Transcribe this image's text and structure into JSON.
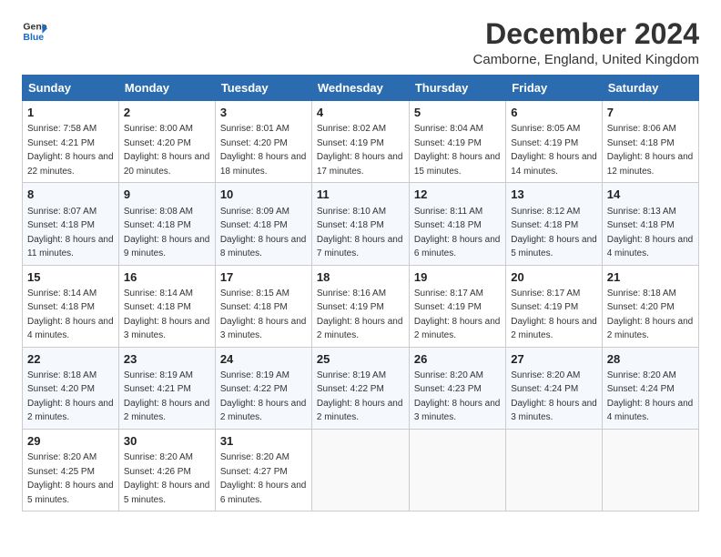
{
  "logo": {
    "line1": "General",
    "line2": "Blue"
  },
  "title": "December 2024",
  "location": "Camborne, England, United Kingdom",
  "days_of_week": [
    "Sunday",
    "Monday",
    "Tuesday",
    "Wednesday",
    "Thursday",
    "Friday",
    "Saturday"
  ],
  "weeks": [
    [
      {
        "day": "1",
        "sunrise": "7:58 AM",
        "sunset": "4:21 PM",
        "daylight": "8 hours and 22 minutes."
      },
      {
        "day": "2",
        "sunrise": "8:00 AM",
        "sunset": "4:20 PM",
        "daylight": "8 hours and 20 minutes."
      },
      {
        "day": "3",
        "sunrise": "8:01 AM",
        "sunset": "4:20 PM",
        "daylight": "8 hours and 18 minutes."
      },
      {
        "day": "4",
        "sunrise": "8:02 AM",
        "sunset": "4:19 PM",
        "daylight": "8 hours and 17 minutes."
      },
      {
        "day": "5",
        "sunrise": "8:04 AM",
        "sunset": "4:19 PM",
        "daylight": "8 hours and 15 minutes."
      },
      {
        "day": "6",
        "sunrise": "8:05 AM",
        "sunset": "4:19 PM",
        "daylight": "8 hours and 14 minutes."
      },
      {
        "day": "7",
        "sunrise": "8:06 AM",
        "sunset": "4:18 PM",
        "daylight": "8 hours and 12 minutes."
      }
    ],
    [
      {
        "day": "8",
        "sunrise": "8:07 AM",
        "sunset": "4:18 PM",
        "daylight": "8 hours and 11 minutes."
      },
      {
        "day": "9",
        "sunrise": "8:08 AM",
        "sunset": "4:18 PM",
        "daylight": "8 hours and 9 minutes."
      },
      {
        "day": "10",
        "sunrise": "8:09 AM",
        "sunset": "4:18 PM",
        "daylight": "8 hours and 8 minutes."
      },
      {
        "day": "11",
        "sunrise": "8:10 AM",
        "sunset": "4:18 PM",
        "daylight": "8 hours and 7 minutes."
      },
      {
        "day": "12",
        "sunrise": "8:11 AM",
        "sunset": "4:18 PM",
        "daylight": "8 hours and 6 minutes."
      },
      {
        "day": "13",
        "sunrise": "8:12 AM",
        "sunset": "4:18 PM",
        "daylight": "8 hours and 5 minutes."
      },
      {
        "day": "14",
        "sunrise": "8:13 AM",
        "sunset": "4:18 PM",
        "daylight": "8 hours and 4 minutes."
      }
    ],
    [
      {
        "day": "15",
        "sunrise": "8:14 AM",
        "sunset": "4:18 PM",
        "daylight": "8 hours and 4 minutes."
      },
      {
        "day": "16",
        "sunrise": "8:14 AM",
        "sunset": "4:18 PM",
        "daylight": "8 hours and 3 minutes."
      },
      {
        "day": "17",
        "sunrise": "8:15 AM",
        "sunset": "4:18 PM",
        "daylight": "8 hours and 3 minutes."
      },
      {
        "day": "18",
        "sunrise": "8:16 AM",
        "sunset": "4:19 PM",
        "daylight": "8 hours and 2 minutes."
      },
      {
        "day": "19",
        "sunrise": "8:17 AM",
        "sunset": "4:19 PM",
        "daylight": "8 hours and 2 minutes."
      },
      {
        "day": "20",
        "sunrise": "8:17 AM",
        "sunset": "4:19 PM",
        "daylight": "8 hours and 2 minutes."
      },
      {
        "day": "21",
        "sunrise": "8:18 AM",
        "sunset": "4:20 PM",
        "daylight": "8 hours and 2 minutes."
      }
    ],
    [
      {
        "day": "22",
        "sunrise": "8:18 AM",
        "sunset": "4:20 PM",
        "daylight": "8 hours and 2 minutes."
      },
      {
        "day": "23",
        "sunrise": "8:19 AM",
        "sunset": "4:21 PM",
        "daylight": "8 hours and 2 minutes."
      },
      {
        "day": "24",
        "sunrise": "8:19 AM",
        "sunset": "4:22 PM",
        "daylight": "8 hours and 2 minutes."
      },
      {
        "day": "25",
        "sunrise": "8:19 AM",
        "sunset": "4:22 PM",
        "daylight": "8 hours and 2 minutes."
      },
      {
        "day": "26",
        "sunrise": "8:20 AM",
        "sunset": "4:23 PM",
        "daylight": "8 hours and 3 minutes."
      },
      {
        "day": "27",
        "sunrise": "8:20 AM",
        "sunset": "4:24 PM",
        "daylight": "8 hours and 3 minutes."
      },
      {
        "day": "28",
        "sunrise": "8:20 AM",
        "sunset": "4:24 PM",
        "daylight": "8 hours and 4 minutes."
      }
    ],
    [
      {
        "day": "29",
        "sunrise": "8:20 AM",
        "sunset": "4:25 PM",
        "daylight": "8 hours and 5 minutes."
      },
      {
        "day": "30",
        "sunrise": "8:20 AM",
        "sunset": "4:26 PM",
        "daylight": "8 hours and 5 minutes."
      },
      {
        "day": "31",
        "sunrise": "8:20 AM",
        "sunset": "4:27 PM",
        "daylight": "8 hours and 6 minutes."
      },
      null,
      null,
      null,
      null
    ]
  ],
  "labels": {
    "sunrise": "Sunrise:",
    "sunset": "Sunset:",
    "daylight": "Daylight:"
  }
}
